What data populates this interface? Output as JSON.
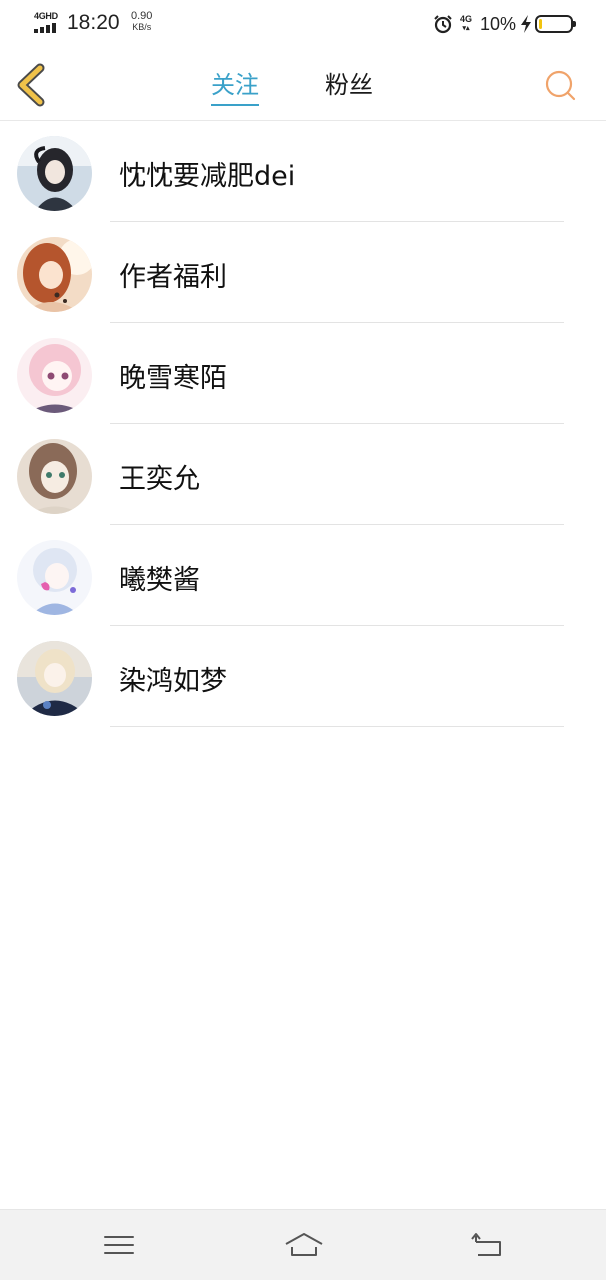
{
  "status_bar": {
    "network": "4GHD",
    "time": "18:20",
    "speed_value": "0.90",
    "speed_unit": "KB/s",
    "network_right": "4G",
    "battery": "10%",
    "battery_level": 0.1,
    "battery_color": "#f2c40f",
    "icons": [
      "signal-icon",
      "alarm-icon",
      "charging-icon",
      "battery-icon"
    ]
  },
  "header": {
    "back_icon": "chevron-left-icon",
    "tabs": [
      {
        "label": "关注",
        "active": true
      },
      {
        "label": "粉丝",
        "active": false
      }
    ],
    "search_icon": "search-icon",
    "accent_color": "#3aa1c9",
    "back_color": "#f0c24a",
    "search_color": "#f0a36a"
  },
  "users": [
    {
      "name": "忱忱要减肥dei"
    },
    {
      "name": "作者福利"
    },
    {
      "name": "晚雪寒陌"
    },
    {
      "name": "王奕允"
    },
    {
      "name": "曦樊酱"
    },
    {
      "name": "染鸿如梦"
    }
  ],
  "nav_bar": {
    "icons": [
      "menu-icon",
      "home-icon",
      "back-icon"
    ]
  }
}
